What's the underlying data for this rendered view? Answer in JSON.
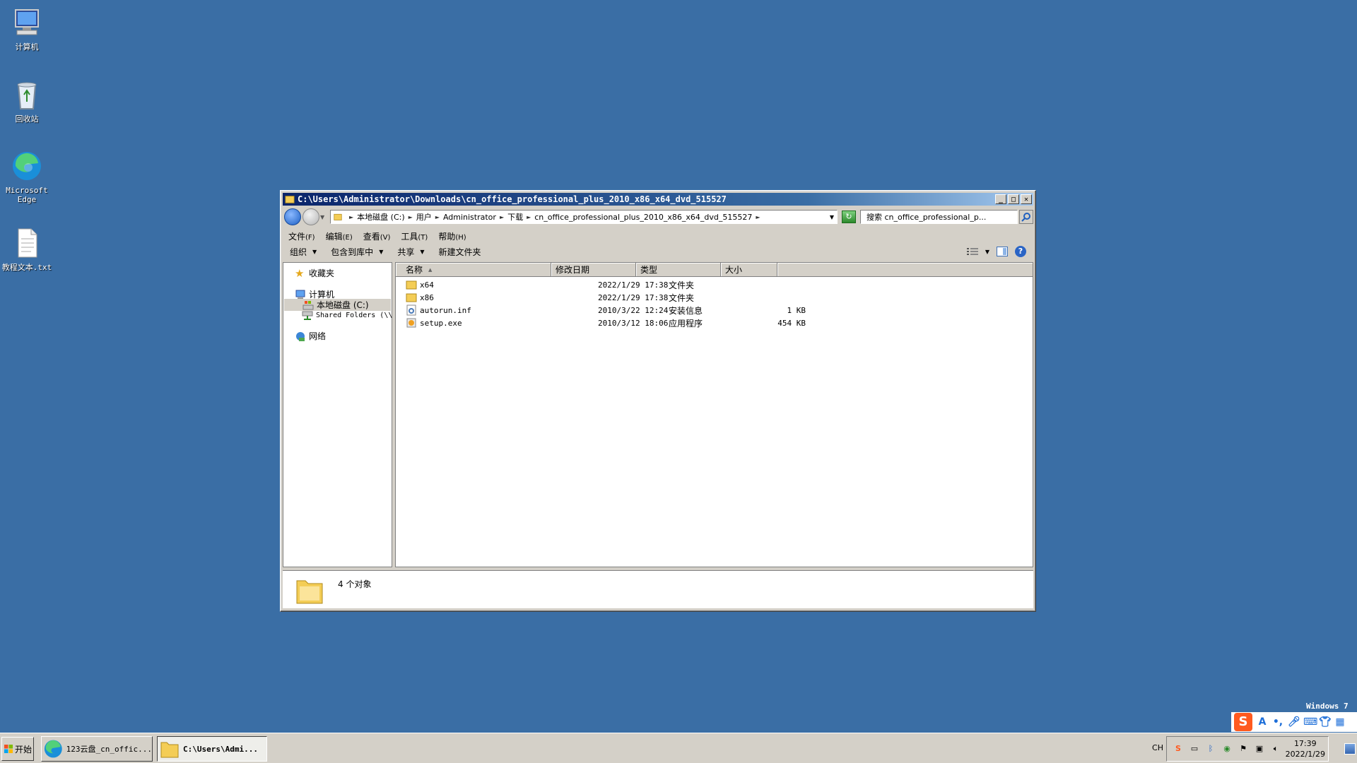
{
  "desktop": {
    "icons": [
      {
        "label": "计算机",
        "icon": "computer-icon"
      },
      {
        "label": "回收站",
        "icon": "recycle-bin-icon"
      },
      {
        "label": "Microsoft Edge",
        "icon": "edge-icon"
      },
      {
        "label": "教程文本.txt",
        "icon": "text-file-icon"
      }
    ],
    "os_label": "Windows 7"
  },
  "window": {
    "title": "C:\\Users\\Administrator\\Downloads\\cn_office_professional_plus_2010_x86_x64_dvd_515527",
    "address": {
      "crumbs": [
        "本地磁盘 (C:)",
        "用户",
        "Administrator",
        "下载",
        "cn_office_professional_plus_2010_x86_x64_dvd_515527"
      ]
    },
    "search_placeholder": "搜索 cn_office_professional_p...",
    "menu": [
      {
        "label": "文件",
        "key": "(F)"
      },
      {
        "label": "编辑",
        "key": "(E)"
      },
      {
        "label": "查看",
        "key": "(V)"
      },
      {
        "label": "工具",
        "key": "(T)"
      },
      {
        "label": "帮助",
        "key": "(H)"
      }
    ],
    "commands": {
      "organize": "组织",
      "include_library": "包含到库中",
      "share": "共享",
      "new_folder": "新建文件夹"
    },
    "nav": {
      "favorites": "收藏夹",
      "computer": "计算机",
      "local_disk": "本地磁盘 (C:)",
      "shared_folders": "Shared Folders (\\\\",
      "network": "网络"
    },
    "columns": {
      "name": "名称",
      "modified": "修改日期",
      "type": "类型",
      "size": "大小"
    },
    "files": [
      {
        "name": "x64",
        "modified": "2022/1/29 17:38",
        "type": "文件夹",
        "size": "",
        "icon": "folder-icon"
      },
      {
        "name": "x86",
        "modified": "2022/1/29 17:38",
        "type": "文件夹",
        "size": "",
        "icon": "folder-icon"
      },
      {
        "name": "autorun.inf",
        "modified": "2010/3/22 12:24",
        "type": "安装信息",
        "size": "1 KB",
        "icon": "settings-file-icon"
      },
      {
        "name": "setup.exe",
        "modified": "2010/3/12 18:06",
        "type": "应用程序",
        "size": "454 KB",
        "icon": "setup-exe-icon"
      }
    ],
    "status": "4 个对象"
  },
  "taskbar": {
    "start": "开始",
    "buttons": [
      {
        "label": "123云盘_cn_offic...",
        "icon": "edge-icon"
      },
      {
        "label": "C:\\Users\\Admi...",
        "icon": "folder-icon"
      }
    ],
    "lang": "CH",
    "clock_time": "17:39",
    "clock_date": "2022/1/29"
  },
  "colors": {
    "desktop": "#3a6ea5",
    "title_start": "#0a246a",
    "title_end": "#a6caf0",
    "ime_accent": "#ff5a1f"
  }
}
